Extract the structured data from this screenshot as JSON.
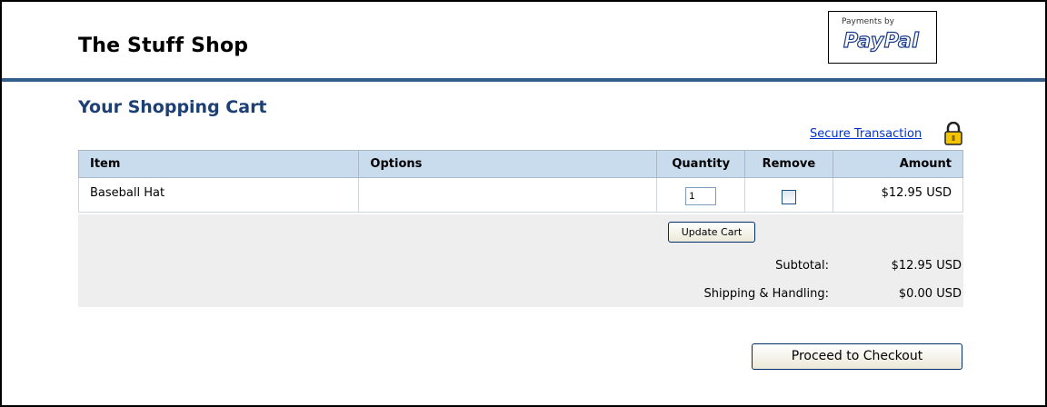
{
  "header": {
    "shop_name": "The Stuff Shop"
  },
  "paypal": {
    "line1": "Payments by",
    "logo": "PayPal"
  },
  "cart": {
    "title": "Your Shopping Cart",
    "secure_link": "Secure Transaction",
    "lock_icon": "padlock-icon",
    "columns": [
      "Item",
      "Options",
      "Quantity",
      "Remove",
      "Amount"
    ],
    "rows": [
      {
        "item": "Baseball Hat",
        "options": "",
        "quantity": "1",
        "remove_checked": false,
        "amount": "$12.95 USD"
      }
    ],
    "update_button": "Update Cart",
    "subtotal_label": "Subtotal:",
    "subtotal_value": "$12.95 USD",
    "shipping_label": "Shipping & Handling:",
    "shipping_value": "$0.00 USD",
    "checkout_button": "Proceed to Checkout"
  },
  "colors": {
    "header_rule": "#325e8c",
    "title": "#1c3f74",
    "table_header": "#c9dcee",
    "link": "#0033cc"
  }
}
